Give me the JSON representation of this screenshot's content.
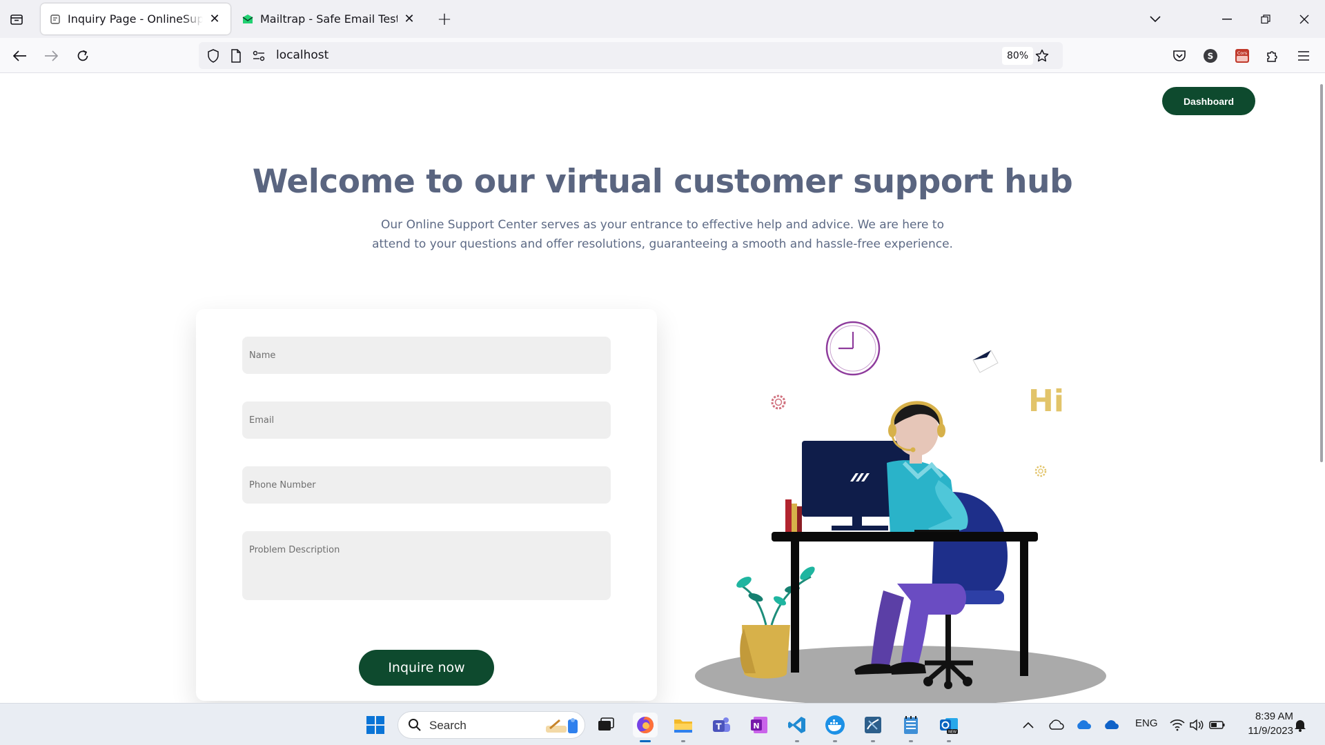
{
  "browser": {
    "tabs": [
      {
        "title": "Inquiry Page - OnlineSupportSy",
        "active": true,
        "favicon": "page-icon"
      },
      {
        "title": "Mailtrap - Safe Email Testing",
        "active": false,
        "favicon": "mailtrap-icon"
      }
    ],
    "url": "localhost",
    "zoom": "80%",
    "profile_initial": "S",
    "cors_label": "Cors\nE"
  },
  "page": {
    "dashboard_label": "Dashboard",
    "title": "Welcome to our virtual customer support hub",
    "subtitle": "Our Online Support Center serves as your entrance to effective help and advice. We are here to attend to your questions and offer resolutions, guaranteeing a smooth and hassle-free experience.",
    "form": {
      "name_placeholder": "Name",
      "email_placeholder": "Email",
      "phone_placeholder": "Phone Number",
      "description_placeholder": "Problem Description",
      "submit_label": "Inquire now"
    },
    "illustration_text": "Hi"
  },
  "taskbar": {
    "search_label": "Search",
    "language": "ENG",
    "time": "8:39 AM",
    "date": "11/9/2023"
  },
  "colors": {
    "brand_green": "#0e4a2e",
    "title_slate": "#5a6580",
    "field_bg": "#efefef"
  }
}
